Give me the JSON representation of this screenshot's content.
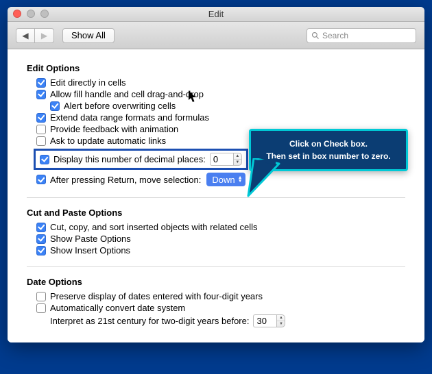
{
  "window": {
    "title": "Edit"
  },
  "toolbar": {
    "showAll": "Show All",
    "searchPlaceholder": "Search"
  },
  "sections": {
    "edit": {
      "title": "Edit Options",
      "editDirectly": {
        "checked": true,
        "label": "Edit directly in cells"
      },
      "fillHandle": {
        "checked": true,
        "label": "Allow fill handle and cell drag-and-drop"
      },
      "alertOverwrite": {
        "checked": true,
        "label": "Alert before overwriting cells"
      },
      "extendFormats": {
        "checked": true,
        "label": "Extend data range formats and formulas"
      },
      "provideFeedback": {
        "checked": false,
        "label": "Provide feedback with animation"
      },
      "askUpdateLinks": {
        "checked": false,
        "label": "Ask to update automatic links"
      },
      "decimalPlaces": {
        "checked": true,
        "label": "Display this number of decimal places:",
        "value": "0"
      },
      "afterReturn": {
        "checked": true,
        "label": "After pressing Return, move selection:",
        "value": "Down"
      }
    },
    "cutpaste": {
      "title": "Cut and Paste Options",
      "cutCopySort": {
        "checked": true,
        "label": "Cut, copy, and sort inserted objects with related cells"
      },
      "showPaste": {
        "checked": true,
        "label": "Show Paste Options"
      },
      "showInsert": {
        "checked": true,
        "label": "Show Insert Options"
      }
    },
    "date": {
      "title": "Date Options",
      "preserveDisplay": {
        "checked": false,
        "label": "Preserve display of dates entered with four-digit years"
      },
      "autoConvert": {
        "checked": false,
        "label": "Automatically convert date system"
      },
      "interpretLabel": "Interpret as 21st century for two-digit years before:",
      "interpretValue": "30"
    }
  },
  "callout": {
    "line1": "Click on Check box.",
    "line2": "Then set in box number to zero."
  }
}
